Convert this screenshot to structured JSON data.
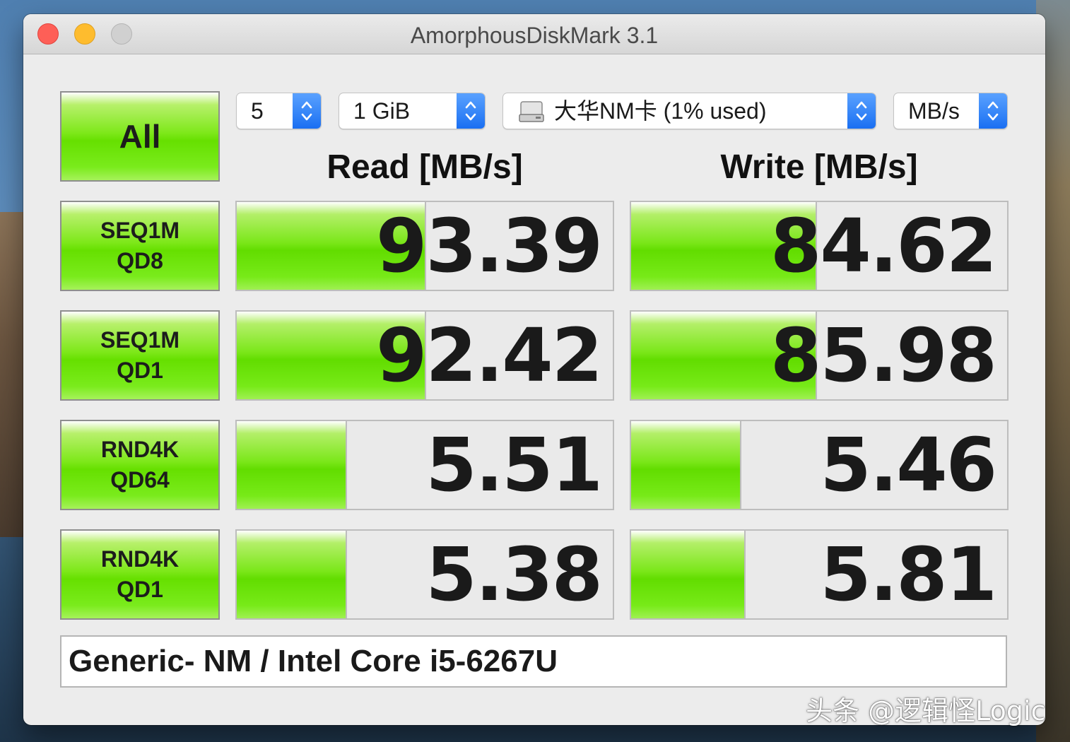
{
  "window": {
    "title": "AmorphousDiskMark 3.1"
  },
  "controls": {
    "all_label": "All",
    "count_value": "5",
    "size_value": "1 GiB",
    "drive_value": "大华NM卡 (1% used)",
    "unit_value": "MB/s"
  },
  "headers": {
    "read": "Read [MB/s]",
    "write": "Write [MB/s]"
  },
  "tests": [
    {
      "label": "SEQ1M\nQD8",
      "read": "93.39",
      "write": "84.62",
      "read_fill": 0.5,
      "write_fill": 0.49
    },
    {
      "label": "SEQ1M\nQD1",
      "read": "92.42",
      "write": "85.98",
      "read_fill": 0.5,
      "write_fill": 0.49
    },
    {
      "label": "RND4K\nQD64",
      "read": "5.51",
      "write": "5.46",
      "read_fill": 0.29,
      "write_fill": 0.29
    },
    {
      "label": "RND4K\nQD1",
      "read": "5.38",
      "write": "5.81",
      "read_fill": 0.29,
      "write_fill": 0.3
    }
  ],
  "info": "Generic- NM / Intel Core i5-6267U",
  "watermark": "头条 @逻辑怪Logic",
  "colors": {
    "bar_green": "#66e000",
    "select_blue": "#1a6ff2",
    "close": "#fe5f57",
    "minimize": "#febc2e"
  }
}
